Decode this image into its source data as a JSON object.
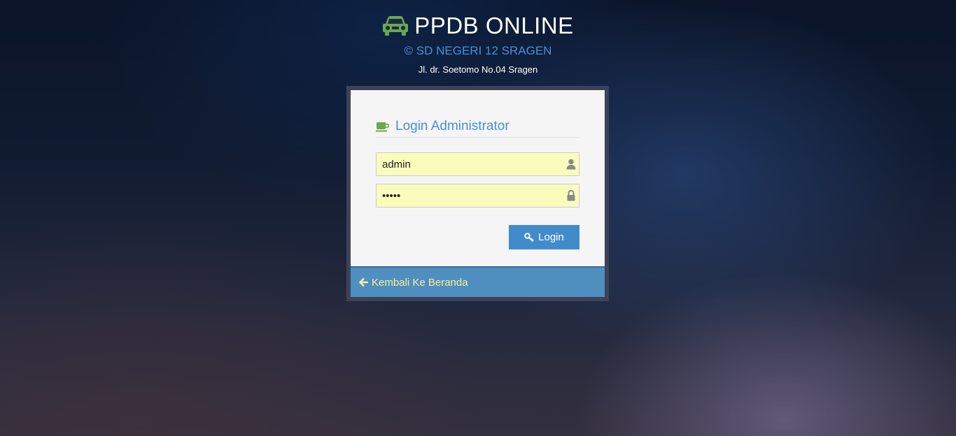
{
  "header": {
    "title": "PPDB ONLINE",
    "title_icon": "car-icon",
    "subtitle": "© SD NEGERI 12 SRAGEN",
    "address": "Jl. dr. Soetomo No.04 Sragen"
  },
  "login": {
    "heading": "Login Administrator",
    "heading_icon": "coffee-cup-icon",
    "username": {
      "value": "admin",
      "icon": "user-icon"
    },
    "password": {
      "value": "admin",
      "icon": "lock-icon"
    },
    "submit_label": "Login",
    "submit_icon": "key-icon",
    "back_label": "Kembali Ke Beranda",
    "back_icon": "arrow-left-icon"
  },
  "colors": {
    "accent_green": "#6aa84f",
    "accent_blue": "#4a8fd6",
    "button_blue": "#428bca",
    "footer_blue": "#4f8fc0",
    "link_yellow": "#ffee99",
    "input_bg": "#fafcbc"
  }
}
